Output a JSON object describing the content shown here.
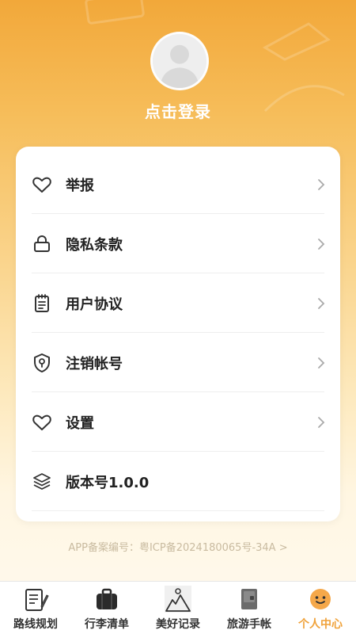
{
  "header": {
    "login_text": "点击登录"
  },
  "menu": {
    "items": [
      {
        "label": "举报",
        "icon": "heart-icon"
      },
      {
        "label": "隐私条款",
        "icon": "lock-icon"
      },
      {
        "label": "用户协议",
        "icon": "notepad-icon"
      },
      {
        "label": "注销帐号",
        "icon": "shield-icon"
      },
      {
        "label": "设置",
        "icon": "heart-icon"
      },
      {
        "label": "版本号1.0.0",
        "icon": "layers-icon"
      }
    ]
  },
  "footer": {
    "icp": "APP备案编号：粤ICP备2024180065号-34A >"
  },
  "tabbar": {
    "tabs": [
      {
        "label": "路线规划",
        "icon": "notebook-pen-icon"
      },
      {
        "label": "行李清单",
        "icon": "suitcase-icon"
      },
      {
        "label": "美好记录",
        "icon": "mountain-sun-icon"
      },
      {
        "label": "旅游手帐",
        "icon": "journal-icon"
      },
      {
        "label": "个人中心",
        "icon": "smiley-face-icon",
        "active": true
      }
    ]
  },
  "colors": {
    "accent": "#f0a23a",
    "text": "#222222",
    "icp": "#c9bba0"
  }
}
